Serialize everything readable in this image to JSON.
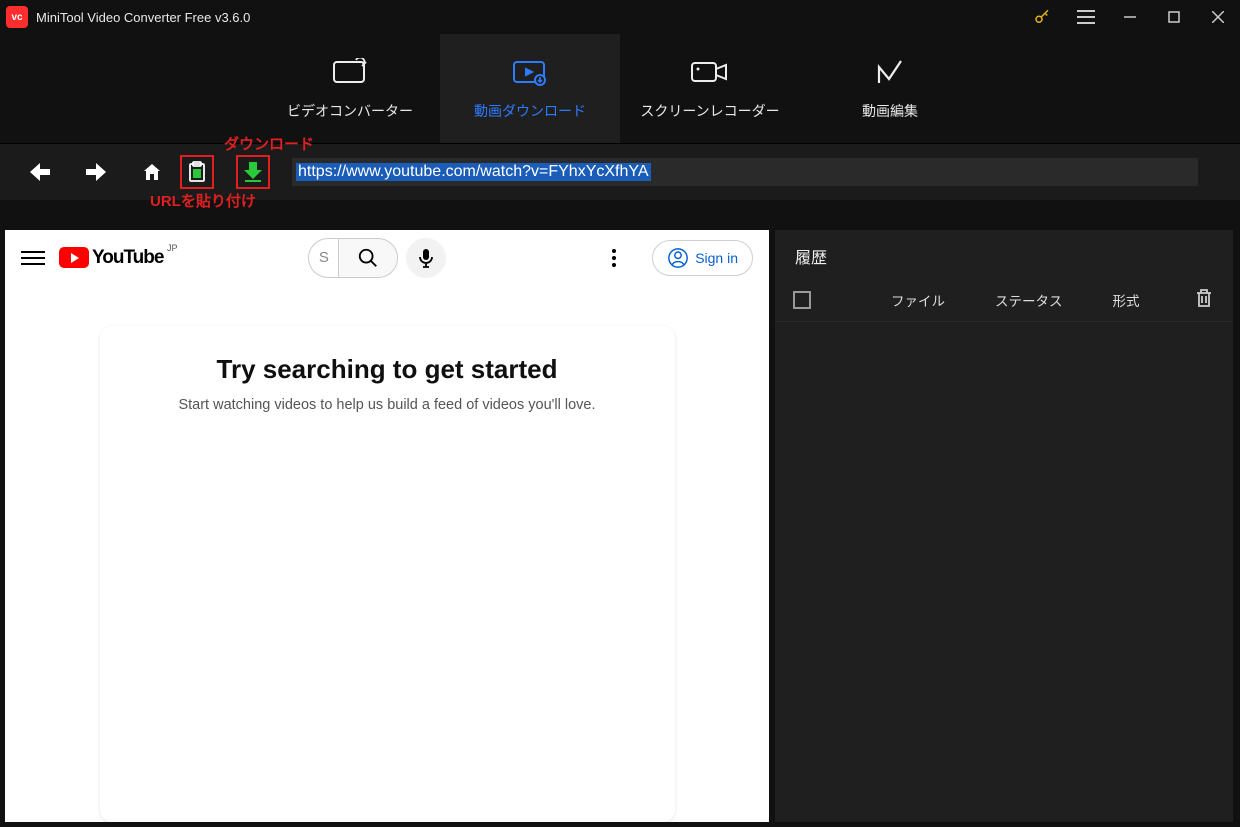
{
  "titlebar": {
    "app_title": "MiniTool Video Converter Free v3.6.0",
    "logo_text": "vc"
  },
  "tabs": {
    "converter": "ビデオコンバーター",
    "download": "動画ダウンロード",
    "recorder": "スクリーンレコーダー",
    "editor": "動画編集"
  },
  "annotations": {
    "download": "ダウンロード",
    "paste_url": "URLを貼り付け"
  },
  "url_bar": {
    "value": "https://www.youtube.com/watch?v=FYhxYcXfhYA"
  },
  "youtube": {
    "region": "JP",
    "logo_text": "YouTube",
    "search_placeholder": "S",
    "sign_in": "Sign in",
    "card_heading": "Try searching to get started",
    "card_body": "Start watching videos to help us build a feed of videos you'll love."
  },
  "history": {
    "title": "履歴",
    "col_file": "ファイル",
    "col_status": "ステータス",
    "col_format": "形式"
  }
}
